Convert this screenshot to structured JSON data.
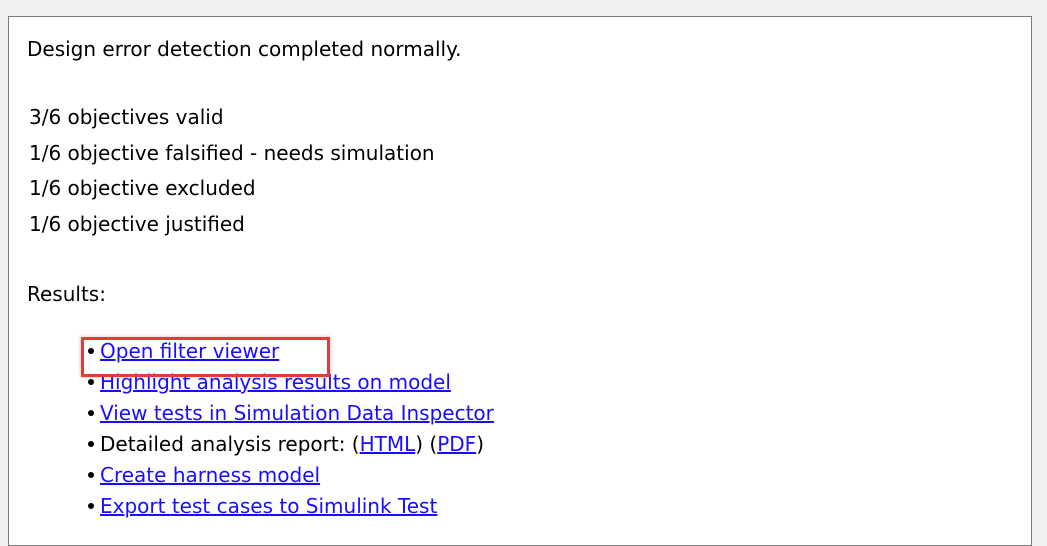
{
  "status": {
    "message": "Design error detection completed normally."
  },
  "objectives": [
    "3/6 objectives valid",
    "1/6 objective falsified - needs simulation",
    "1/6 objective excluded",
    "1/6 objective justified"
  ],
  "results": {
    "heading": "Results:",
    "links": {
      "open_filter_viewer": "Open filter viewer",
      "highlight_results": "Highlight analysis results on model",
      "view_tests_sdi": "View tests in Simulation Data Inspector",
      "report_prefix": "Detailed analysis report: (",
      "report_html": "HTML",
      "report_mid": ") (",
      "report_pdf": "PDF",
      "report_suffix": ")",
      "create_harness": "Create harness model",
      "export_test_cases": "Export test cases to Simulink Test"
    }
  },
  "colors": {
    "link": "#1a0dff",
    "highlight": "#e03c3c"
  }
}
